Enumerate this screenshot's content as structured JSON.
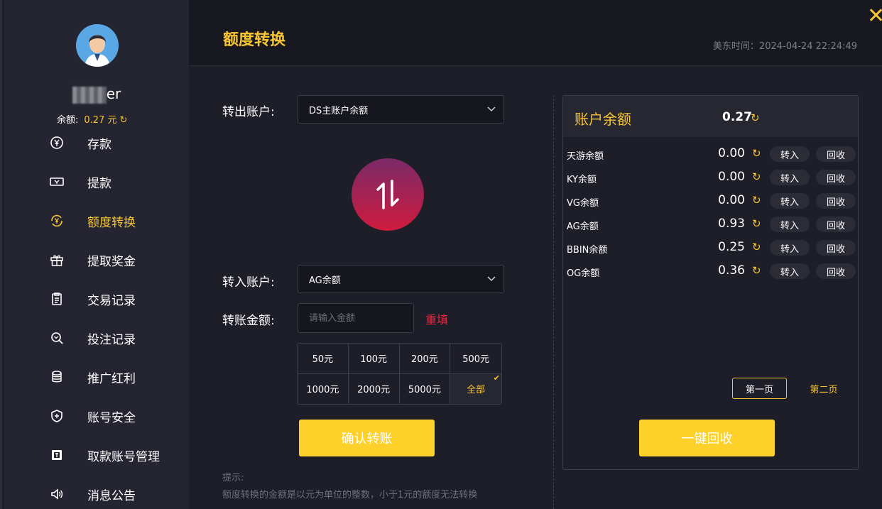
{
  "user": {
    "name_suffix": "er",
    "balance_label": "余额:",
    "balance_value": "0.27 元"
  },
  "sidebar": {
    "items": [
      {
        "label": "存款",
        "icon": "yen-circle-icon"
      },
      {
        "label": "提款",
        "icon": "ticket-icon"
      },
      {
        "label": "额度转换",
        "icon": "exchange-yen-icon",
        "active": true
      },
      {
        "label": "提取奖金",
        "icon": "gift-icon"
      },
      {
        "label": "交易记录",
        "icon": "clipboard-icon"
      },
      {
        "label": "投注记录",
        "icon": "search-record-icon"
      },
      {
        "label": "推广红利",
        "icon": "coins-icon"
      },
      {
        "label": "账号安全",
        "icon": "shield-icon"
      },
      {
        "label": "取款账号管理",
        "icon": "card-icon"
      },
      {
        "label": "消息公告",
        "icon": "speaker-icon"
      }
    ]
  },
  "header": {
    "title": "额度转换",
    "time_text": "美东时间：2024-04-24 22:24:49"
  },
  "form": {
    "out_label": "转出账户:",
    "out_value": "DS主账户余额",
    "in_label": "转入账户:",
    "in_value": "AG余额",
    "amount_label": "转账金额:",
    "amount_placeholder": "请输入金额",
    "reset_label": "重填",
    "quick_amounts": [
      "50元",
      "100元",
      "200元",
      "500元",
      "1000元",
      "2000元",
      "5000元",
      "全部"
    ],
    "confirm_label": "确认转账",
    "hint_title": "提示:",
    "hint_text": "额度转换的金额是以元为单位的整数，小于1元的额度无法转换"
  },
  "panel": {
    "title": "账户余额",
    "total": "0.27",
    "transfer_in_label": "转入",
    "recycle_label": "回收",
    "rows": [
      {
        "name": "天游余额",
        "amount": "0.00"
      },
      {
        "name": "KY余额",
        "amount": "0.00"
      },
      {
        "name": "VG余额",
        "amount": "0.00"
      },
      {
        "name": "AG余额",
        "amount": "0.93"
      },
      {
        "name": "BBIN余额",
        "amount": "0.25"
      },
      {
        "name": "OG余额",
        "amount": "0.36"
      }
    ],
    "page1": "第一页",
    "page2": "第二页",
    "recycle_all_label": "一键回收"
  },
  "colors": {
    "accent": "#f7c534",
    "button": "#fdd02a",
    "danger": "#e6293f"
  }
}
